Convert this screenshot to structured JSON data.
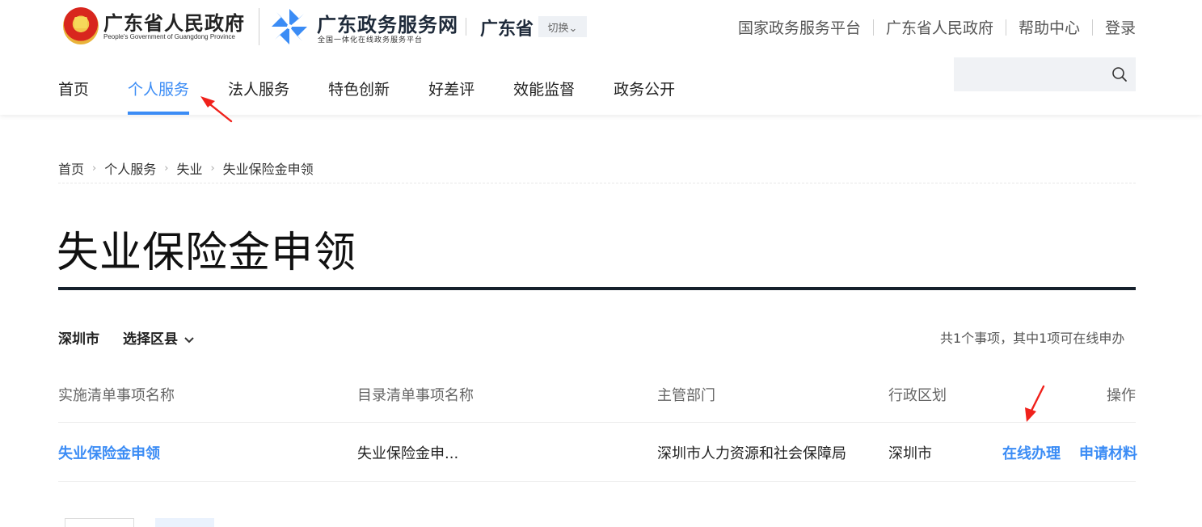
{
  "header": {
    "gov_title": "广东省人民政府",
    "gov_subtitle": "People's Government of Guangdong Province",
    "site_title": "广东政务服务网",
    "site_subtitle": "全国一体化在线政务服务平台",
    "province": "广东省",
    "switch_label": "切换⌄",
    "top_links": [
      "国家政务服务平台",
      "广东省人民政府",
      "帮助中心",
      "登录"
    ]
  },
  "nav": {
    "items": [
      "首页",
      "个人服务",
      "法人服务",
      "特色创新",
      "好差评",
      "效能监督",
      "政务公开"
    ],
    "active": "个人服务"
  },
  "search": {
    "placeholder": ""
  },
  "breadcrumb": [
    "首页",
    "个人服务",
    "失业",
    "失业保险金申领"
  ],
  "page_title": "失业保险金申领",
  "filter": {
    "city": "深圳市",
    "district_label": "选择区县",
    "summary": "共1个事项，其中1项可在线申办"
  },
  "table": {
    "headers": [
      "实施清单事项名称",
      "目录清单事项名称",
      "主管部门",
      "行政区划",
      "操作"
    ],
    "rows": [
      {
        "name": "失业保险金申领",
        "catalog": "失业保险金申...",
        "department": "深圳市人力资源和社会保障局",
        "region": "深圳市",
        "actions": [
          "在线办理",
          "申请材料"
        ]
      }
    ]
  },
  "colors": {
    "accent": "#3b8cf5",
    "title_rule": "#16202c",
    "arrow": "#f0211b"
  },
  "icons": {
    "emblem": "national-emblem-icon",
    "site_logo": "pinwheel-logo-icon",
    "search": "search-icon",
    "caret": "chevron-down-icon",
    "breadcrumb_sep": "chevron-right-icon"
  }
}
